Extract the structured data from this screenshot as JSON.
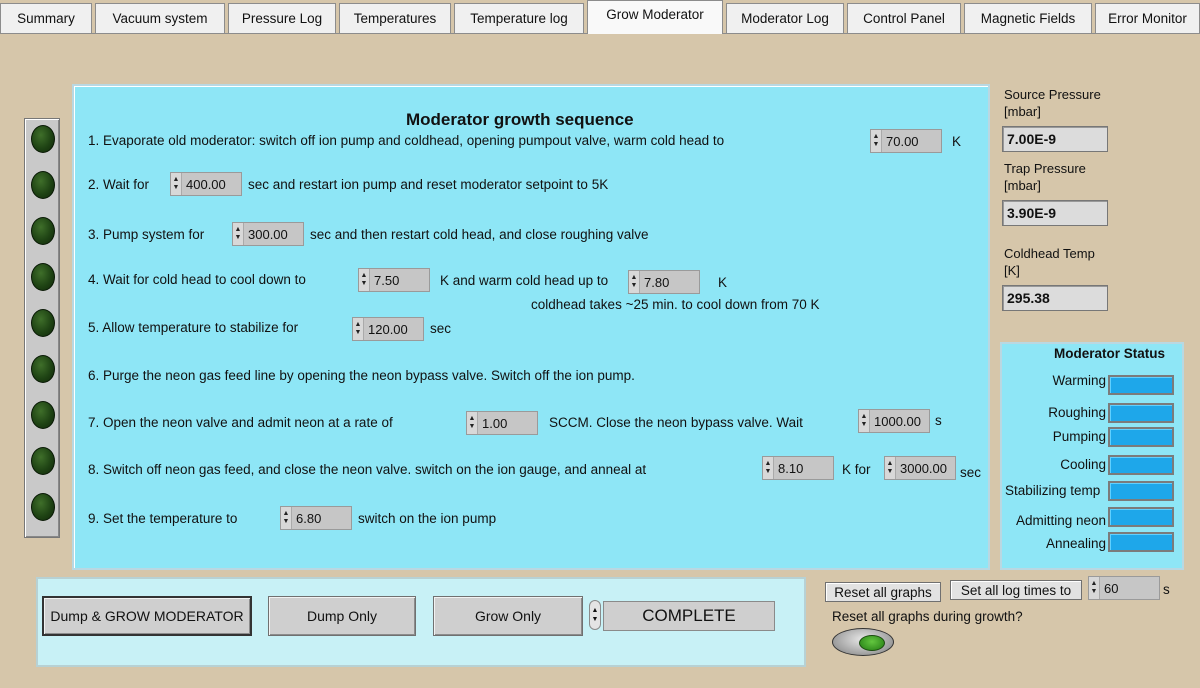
{
  "tabs": [
    "Summary",
    "Vacuum system",
    "Pressure Log",
    "Temperatures",
    "Temperature log",
    "Grow Moderator",
    "Moderator Log",
    "Control Panel",
    "Magnetic Fields",
    "Error Monitor"
  ],
  "active_tab": "Grow Moderator",
  "sequence": {
    "title": "Moderator growth sequence",
    "step1": {
      "text": "1. Evaporate old moderator: switch off ion pump and coldhead,  opening pumpout valve,  warm cold head to",
      "value": "70.00",
      "unit": "K"
    },
    "step2": {
      "text_a": "2. Wait for",
      "value": "400.00",
      "text_b": "sec and restart ion pump and reset moderator setpoint to 5K"
    },
    "step3": {
      "text_a": "3. Pump system for",
      "value": "300.00",
      "text_b": "sec and then restart cold head, and close roughing valve"
    },
    "step4": {
      "text_a": "4. Wait for cold head to cool down to",
      "value_a": "7.50",
      "text_b": "K and warm cold head up to",
      "value_b": "7.80",
      "unit": "K",
      "note": "coldhead takes ~25 min. to cool down from 70 K"
    },
    "step5": {
      "text_a": "5. Allow temperature to stabilize for",
      "value": "120.00",
      "unit": "sec"
    },
    "step6": {
      "text": "6. Purge the neon gas feed line by opening the neon bypass valve. Switch off the ion pump."
    },
    "step7": {
      "text_a": "7. Open the neon  valve and admit neon at a rate of",
      "value_a": "1.00",
      "text_b": "SCCM. Close the neon bypass valve. Wait",
      "value_b": "1000.00",
      "unit": "s"
    },
    "step8": {
      "text_a": "8. Switch off neon gas feed, and close the neon valve. switch on the ion gauge, and anneal at",
      "value_a": "8.10",
      "text_b": "K for",
      "value_b": "3000.00",
      "unit": "sec"
    },
    "step9": {
      "text_a": "9. Set the temperature to",
      "value": "6.80",
      "text_b": "switch on the ion pump"
    }
  },
  "readouts": {
    "source_pressure": {
      "label_a": "Source Pressure",
      "label_b": "[mbar]",
      "value": "7.00E-9"
    },
    "trap_pressure": {
      "label_a": "Trap Pressure",
      "label_b": "[mbar]",
      "value": "3.90E-9"
    },
    "coldhead_temp": {
      "label_a": "Coldhead Temp",
      "label_b": "[K]",
      "value": "295.38"
    }
  },
  "moderator_status": {
    "title": "Moderator Status",
    "items": [
      "Warming",
      "Roughing",
      "Pumping",
      "Cooling",
      "Stabilizing temp",
      "Admitting neon",
      "Annealing"
    ]
  },
  "controls": {
    "dump_grow": "Dump & GROW MODERATOR",
    "dump_only": "Dump Only",
    "grow_only": "Grow Only",
    "state": "COMPLETE"
  },
  "graphs": {
    "reset_all": "Reset  all graphs",
    "set_log_times": "Set all log times to",
    "log_time_value": "60",
    "log_time_unit": "s",
    "reset_question": "Reset all graphs during growth?"
  },
  "colors": {
    "panel": "#8ee6f6",
    "background": "#d6c6aa",
    "status_bar": "#1ea7ea",
    "led_off": "#1f4414",
    "toggle_on": "#2f8a1c"
  }
}
